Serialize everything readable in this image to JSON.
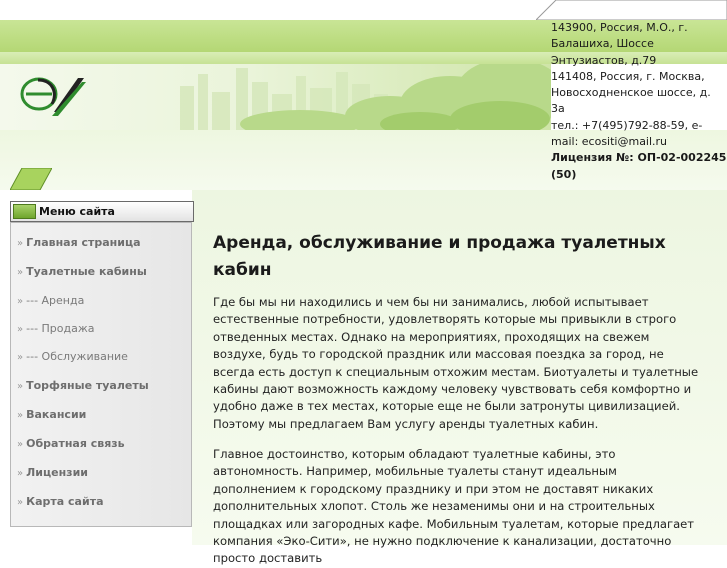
{
  "contacts": {
    "addr1": "143900, Россия, М.О., г. Балашиха, Шоссе Энтузиастов, д.79",
    "addr2": "141408, Россия, г. Москва, Новосходненское шоссе, д. 3а",
    "phone": "тел.: +7(495)792-88-59, e-mail: ecositi@mail.ru",
    "license": "Лицензия №: ОП-02-002245 (50)"
  },
  "menu": {
    "title": "Меню сайта",
    "items": [
      {
        "label": "Главная страница",
        "bold": true
      },
      {
        "label": "Туалетные кабины",
        "bold": true
      },
      {
        "label": "--- Аренда",
        "bold": false
      },
      {
        "label": "--- Продажа",
        "bold": false
      },
      {
        "label": "--- Обслуживание",
        "bold": false
      },
      {
        "label": "Торфяные туалеты",
        "bold": true
      },
      {
        "label": "Вакансии",
        "bold": true
      },
      {
        "label": "Обратная связь",
        "bold": true
      },
      {
        "label": "Лицензии",
        "bold": true
      },
      {
        "label": "Карта сайта",
        "bold": true
      }
    ]
  },
  "content": {
    "title": "Аренда, обслуживание и продажа туалетных кабин",
    "p1": "Где бы мы ни находились и чем бы ни занимались, любой испытывает естественные потребности, удовлетворять которые мы привыкли в строго отведенных местах. Однако на мероприятиях, проходящих на свежем воздухе, будь то городской праздник или массовая поездка за город, не всегда есть доступ к специальным отхожим местам. Биотуалеты и туалетные кабины дают возможность каждому человеку чувствовать себя комфортно и удобно даже в тех местах, которые еще не были затронуты цивилизацией. Поэтому мы предлагаем Вам услугу аренды туалетных кабин.",
    "p2": "Главное достоинство, которым обладают туалетные кабины,   это автономность. Например, мобильные туалеты станут идеальным дополнением к городскому празднику и при этом не доставят никаких дополнительных хлопот. Столь же незаменимы они и на строительных площадках или загородных кафе. Мобильным туалетам, которые предлагает компания «Эко-Сити», не нужно подключение к канализации, достаточно просто доставить"
  },
  "colors": {
    "accent": "#9fcf4a",
    "header_band": "#c2e08a",
    "content_bg": "#eef7e3",
    "menu_bg": "#ececec"
  }
}
